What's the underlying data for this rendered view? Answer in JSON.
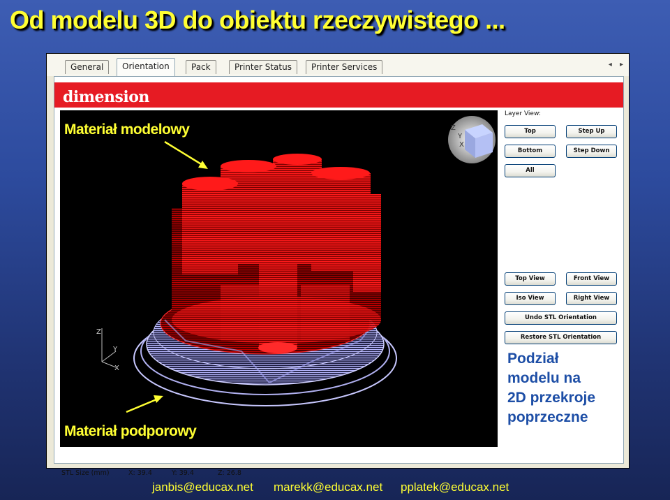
{
  "slide": {
    "title": "Od modelu 3D do obiektu rzeczywistego ...",
    "footer_emails": [
      "janbis@educax.net",
      "marekk@educax.net",
      "pplatek@educax.net"
    ]
  },
  "app": {
    "tabs": [
      {
        "label": "General",
        "active": false
      },
      {
        "label": "Orientation",
        "active": true
      },
      {
        "label": "Pack",
        "active": false
      },
      {
        "label": "Printer Status",
        "active": false
      },
      {
        "label": "Printer Services",
        "active": false
      }
    ],
    "tab_scroll": "◂ ▸",
    "brand": "dimension",
    "viewport": {
      "label_model": "Materiał modelowy",
      "label_support": "Materiał podporowy",
      "axis_z": "Z",
      "axis_y": "Y",
      "axis_x": "X"
    },
    "layer_view": {
      "title": "Layer View:",
      "buttons": {
        "top": "Top",
        "step_up": "Step Up",
        "bottom": "Bottom",
        "step_down": "Step Down",
        "all": "All"
      }
    },
    "view_buttons": {
      "top_view": "Top View",
      "front_view": "Front View",
      "iso_view": "Iso View",
      "right_view": "Right View",
      "undo": "Undo STL Orientation",
      "restore": "Restore STL Orientation"
    },
    "division_text": [
      "Podział",
      "modelu na",
      "2D przekroje",
      "poprzeczne"
    ],
    "status": {
      "stl_size_label": "STL Size (mm)",
      "x": "X:  39.4",
      "y": "Y:  39.4",
      "z": "Z:  26.8"
    },
    "colors": {
      "model": "#ff1a1a",
      "support": "#b8b8ff",
      "brand_red": "#e61b23",
      "label_yellow": "#ffff33",
      "division_blue": "#1d4ea6"
    }
  }
}
